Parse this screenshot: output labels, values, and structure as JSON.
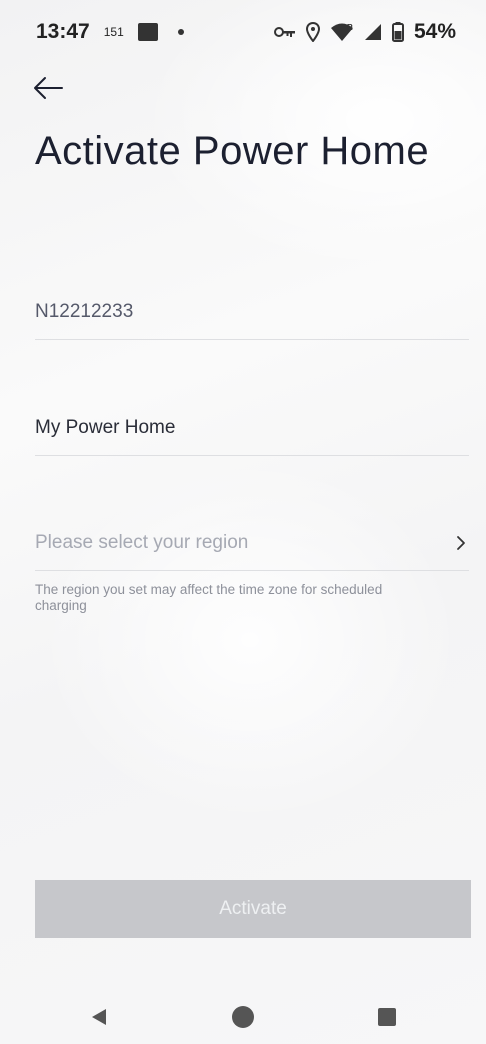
{
  "status_bar": {
    "time": "13:47",
    "notif_count": "151",
    "battery": "54%"
  },
  "header": {
    "back_icon": "arrow-left-icon",
    "title": "Activate Power Home"
  },
  "form": {
    "serial_number": "N12212233",
    "device_name": "My Power Home",
    "region_placeholder": "Please select your region",
    "region_hint": "The region you set may affect the time zone for scheduled charging"
  },
  "actions": {
    "activate_label": "Activate"
  },
  "colors": {
    "title": "#1c2030",
    "button_disabled": "#c6c7cb",
    "hint": "#8d909a"
  },
  "nav": {
    "back": "nav-back-icon",
    "home": "nav-home-icon",
    "recents": "nav-recents-icon"
  }
}
